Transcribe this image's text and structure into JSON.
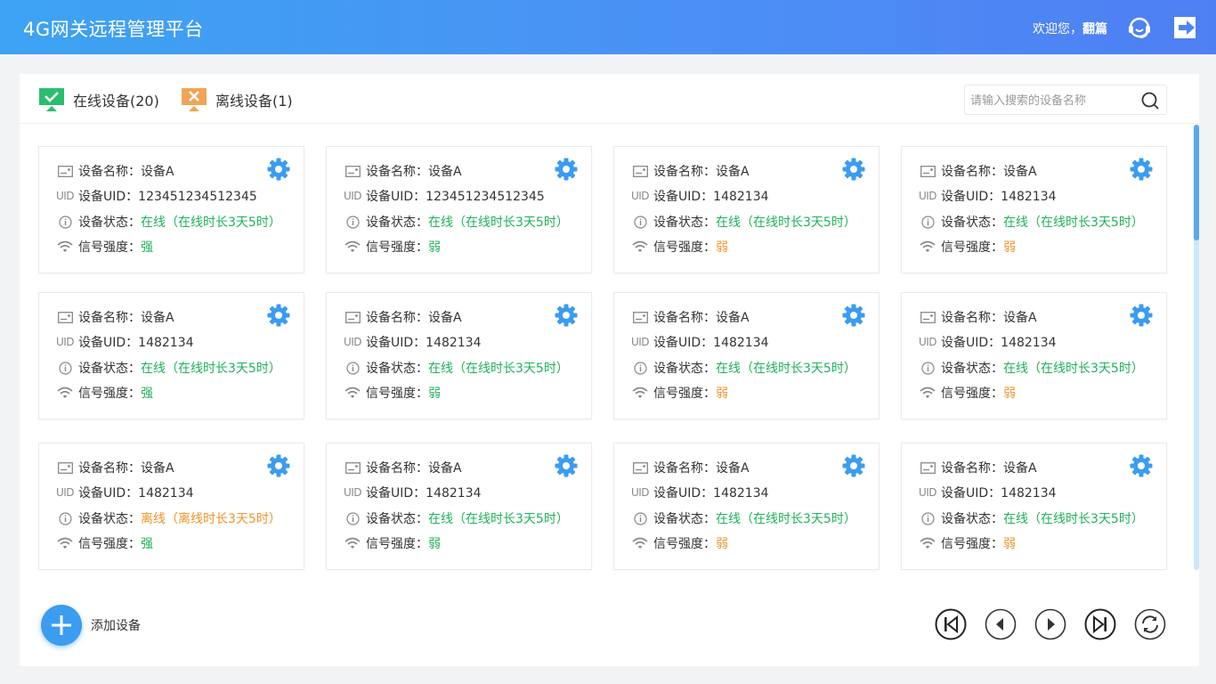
{
  "header": {
    "title": "4G网关远程管理平台",
    "welcome_prefix": "欢迎您，",
    "username": "翻篇",
    "support_icon": "headset-icon",
    "logout_icon": "logout-icon"
  },
  "tabs": [
    {
      "label": "在线设备(20)",
      "icon": "monitor-check-icon",
      "color": "#2bbd6e"
    },
    {
      "label": "离线设备(1)",
      "icon": "monitor-x-icon",
      "color": "#f0a455"
    }
  ],
  "search": {
    "placeholder": "请输入搜索的设备名称"
  },
  "labels": {
    "name": "设备名称：",
    "uid": "设备UID：",
    "uid_tag": "UID",
    "status": "设备状态：",
    "signal": "信号强度："
  },
  "colors": {
    "accent": "#3b9cf0",
    "online": "#1fb15a",
    "offline": "#f0932b",
    "weak": "#f0932b",
    "strong": "#1fb15a"
  },
  "devices": [
    {
      "name": "设备A",
      "uid": "123451234512345",
      "status": "在线（在线时长3天5时）",
      "status_type": "online",
      "signal": "强",
      "signal_type": "strong"
    },
    {
      "name": "设备A",
      "uid": "123451234512345",
      "status": "在线（在线时长3天5时）",
      "status_type": "online",
      "signal": "弱",
      "signal_type": "strong"
    },
    {
      "name": "设备A",
      "uid": "1482134",
      "status": "在线（在线时长3天5时）",
      "status_type": "online",
      "signal": "弱",
      "signal_type": "weak"
    },
    {
      "name": "设备A",
      "uid": "1482134",
      "status": "在线（在线时长3天5时）",
      "status_type": "online",
      "signal": "弱",
      "signal_type": "weak"
    },
    {
      "name": "设备A",
      "uid": "1482134",
      "status": "在线（在线时长3天5时）",
      "status_type": "online",
      "signal": "强",
      "signal_type": "strong"
    },
    {
      "name": "设备A",
      "uid": "1482134",
      "status": "在线（在线时长3天5时）",
      "status_type": "online",
      "signal": "弱",
      "signal_type": "strong"
    },
    {
      "name": "设备A",
      "uid": "1482134",
      "status": "在线（在线时长3天5时）",
      "status_type": "online",
      "signal": "弱",
      "signal_type": "weak"
    },
    {
      "name": "设备A",
      "uid": "1482134",
      "status": "在线（在线时长3天5时）",
      "status_type": "online",
      "signal": "弱",
      "signal_type": "weak"
    },
    {
      "name": "设备A",
      "uid": "1482134",
      "status": "离线（离线时长3天5时）",
      "status_type": "offline",
      "signal": "强",
      "signal_type": "strong"
    },
    {
      "name": "设备A",
      "uid": "1482134",
      "status": "在线（在线时长3天5时）",
      "status_type": "online",
      "signal": "弱",
      "signal_type": "strong"
    },
    {
      "name": "设备A",
      "uid": "1482134",
      "status": "在线（在线时长3天5时）",
      "status_type": "online",
      "signal": "弱",
      "signal_type": "weak"
    },
    {
      "name": "设备A",
      "uid": "1482134",
      "status": "在线（在线时长3天5时）",
      "status_type": "online",
      "signal": "弱",
      "signal_type": "weak"
    }
  ],
  "footer": {
    "add_label": "添加设备",
    "pagination_icons": [
      "first-page-icon",
      "previous-page-icon",
      "next-page-icon",
      "last-page-icon",
      "refresh-icon"
    ]
  }
}
